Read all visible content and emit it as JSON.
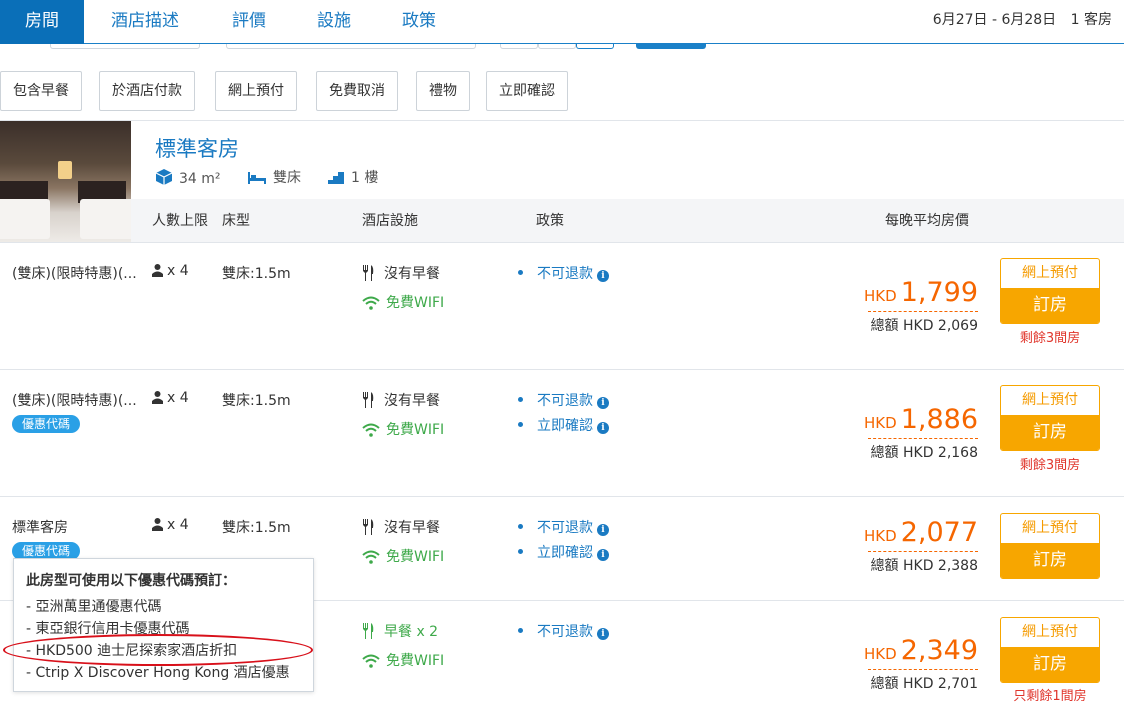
{
  "nav": {
    "tabs": [
      "房間",
      "酒店描述",
      "評價",
      "設施",
      "政策"
    ],
    "date_range": "6月27日 - 6月28日",
    "rooms_count": "1 客房"
  },
  "filters": [
    "包含早餐",
    "於酒店付款",
    "網上預付",
    "免費取消",
    "禮物",
    "立即確認"
  ],
  "room": {
    "title": "標準客房",
    "size": "34 m²",
    "bed": "雙床",
    "floor": "1 樓"
  },
  "columns": {
    "guests": "人數上限",
    "bed": "床型",
    "facilities": "酒店設施",
    "policy": "政策",
    "price": "每晚平均房價"
  },
  "rows": [
    {
      "name": "(雙床)(限時特惠)(...",
      "guests": "x 4",
      "bed": "雙床:1.5m",
      "meal": "沒有早餐",
      "wifi": "免費WIFI",
      "policies": [
        "不可退款"
      ],
      "currency": "HKD",
      "price": "1,799",
      "total": "總額 HKD 2,069",
      "prepay": "網上預付",
      "book": "訂房",
      "left": "剩餘3間房"
    },
    {
      "name": "(雙床)(限時特惠)(...",
      "badge": "優惠代碼",
      "guests": "x 4",
      "bed": "雙床:1.5m",
      "meal": "沒有早餐",
      "wifi": "免費WIFI",
      "policies": [
        "不可退款",
        "立即確認"
      ],
      "currency": "HKD",
      "price": "1,886",
      "total": "總額 HKD 2,168",
      "prepay": "網上預付",
      "book": "訂房",
      "left": "剩餘3間房"
    },
    {
      "name": "標準客房",
      "badge": "優惠代碼",
      "guests": "x 4",
      "bed": "雙床:1.5m",
      "meal": "沒有早餐",
      "wifi": "免費WIFI",
      "policies": [
        "不可退款",
        "立即確認"
      ],
      "currency": "HKD",
      "price": "2,077",
      "total": "總額 HKD 2,388",
      "prepay": "網上預付",
      "book": "訂房"
    },
    {
      "meal": "早餐 x 2",
      "wifi": "免費WIFI",
      "policies": [
        "不可退款"
      ],
      "currency": "HKD",
      "price": "2,349",
      "total": "總額 HKD 2,701",
      "prepay": "網上預付",
      "book": "訂房",
      "left": "只剩餘1間房"
    }
  ],
  "tooltip": {
    "title": "此房型可使用以下優惠代碼預訂：",
    "items": [
      "- 亞洲萬里通優惠代碼",
      "- 東亞銀行信用卡優惠代碼",
      "- HKD500 迪士尼探索家酒店折扣",
      "- Ctrip X Discover Hong Kong 酒店優惠"
    ]
  },
  "colors": {
    "brand_blue": "#0a6fb8",
    "price_orange": "#f56600",
    "book_orange": "#f7a600",
    "alert_red": "#e0352b",
    "wifi_green": "#3ea94a",
    "badge_blue": "#2aa0e6"
  },
  "icons": {
    "size": "cube-icon",
    "bed": "bed-icon",
    "floor": "stairs-icon",
    "guests": "person-icon",
    "meal": "fork-knife-icon",
    "wifi": "wifi-icon",
    "info": "info-icon"
  }
}
